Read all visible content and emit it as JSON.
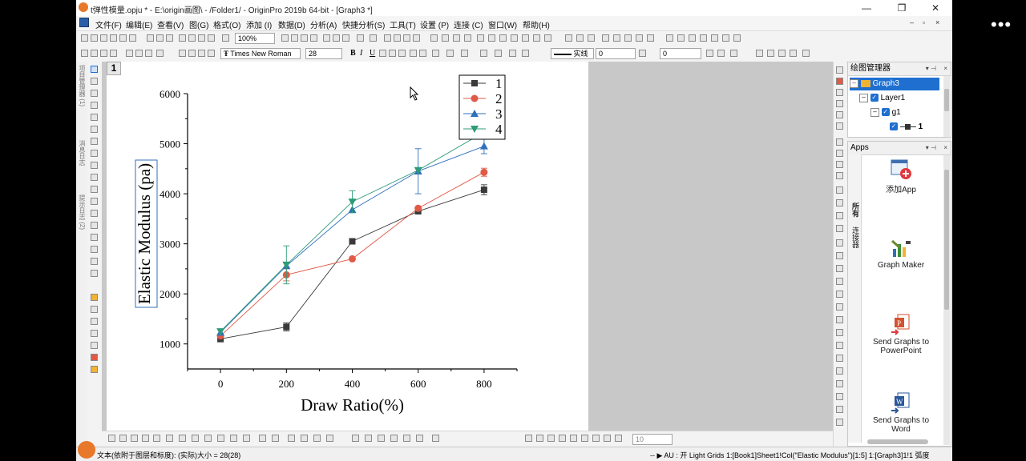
{
  "window": {
    "title": "t弹性模量.opju * - E:\\origin画图\\ - /Folder1/ - OriginPro 2019b 64-bit - [Graph3 *]",
    "min_label": "—",
    "restore_label": "❐",
    "close_label": "✕"
  },
  "menu": {
    "items": [
      "文件(F)",
      "编辑(E)",
      "查看(V)",
      "图(G)",
      "格式(O)",
      "添加 (I)",
      "数据(D)",
      "分析(A)",
      "快捷分析(S)",
      "工具(T)",
      "设置 (P)",
      "连接 (C)",
      "窗口(W)",
      "帮助(H)"
    ],
    "mdi_buttons": [
      "–",
      "▫",
      "×"
    ]
  },
  "toolbar": {
    "zoom_value": "100%",
    "font_name": "Times New Roman",
    "font_size": "28",
    "line_style_label": "实线",
    "line_width": "0",
    "second_width": "0",
    "bold": "B",
    "italic": "I",
    "underline": "U"
  },
  "left_dock": {
    "labels": [
      "项目管理器 (1)",
      "消息日志",
      "提示日志 (2)"
    ]
  },
  "graph": {
    "layer_number": "1",
    "bottom_zoom": "10"
  },
  "chart_data": {
    "type": "line",
    "xlabel": "Draw Ratio(%)",
    "ylabel": "Elastic Modulus (pa)",
    "x": [
      0,
      200,
      400,
      600,
      800
    ],
    "xticks": [
      "0",
      "200",
      "400",
      "600",
      "800"
    ],
    "yticks": [
      "1000",
      "2000",
      "3000",
      "4000",
      "5000",
      "6000"
    ],
    "xlim": [
      -100,
      900
    ],
    "ylim": [
      500,
      6000
    ],
    "legend_position": "top-right",
    "series": [
      {
        "name": "1",
        "values": [
          1100,
          1340,
          3050,
          3650,
          4080
        ],
        "errors": [
          60,
          80,
          0,
          0,
          100
        ],
        "color": "#3a3a3a",
        "marker": "square"
      },
      {
        "name": "2",
        "values": [
          1160,
          2380,
          2700,
          3710,
          4430
        ],
        "errors": [
          0,
          120,
          0,
          0,
          80
        ],
        "color": "#e05a47",
        "marker": "circle"
      },
      {
        "name": "3",
        "values": [
          1230,
          2560,
          3680,
          4450,
          4950
        ],
        "errors": [
          0,
          0,
          0,
          450,
          150
        ],
        "color": "#2f6fbb",
        "marker": "triangle-up"
      },
      {
        "name": "4",
        "values": [
          1250,
          2580,
          3840,
          4470,
          5230
        ],
        "errors": [
          0,
          380,
          220,
          0,
          0
        ],
        "color": "#2f9b7a",
        "marker": "triangle-down"
      }
    ]
  },
  "object_manager": {
    "title": "绘图管理器",
    "items": [
      "Graph3",
      "Layer1",
      "g1",
      "1"
    ]
  },
  "apps": {
    "title": "Apps",
    "tabs": [
      "所有",
      "连接器"
    ],
    "items": [
      "添加App",
      "Graph Maker",
      "Send Graphs to PowerPoint",
      "Send Graphs to Word"
    ]
  },
  "status": {
    "left_text": "文本(依附于图层和标度): (实际)大小 = 28(28)",
    "right_text": "-- ▶ AU : 开  Light Grids  1:[Book1]Sheet1!Col(\"Elastic Modulus\")[1:5]  1:[Graph3]1!1  弧度"
  },
  "colors": {
    "selection": "#1e6fd0",
    "graph_bg": "#ffffff",
    "workspace_bg": "#c8c8c8"
  }
}
